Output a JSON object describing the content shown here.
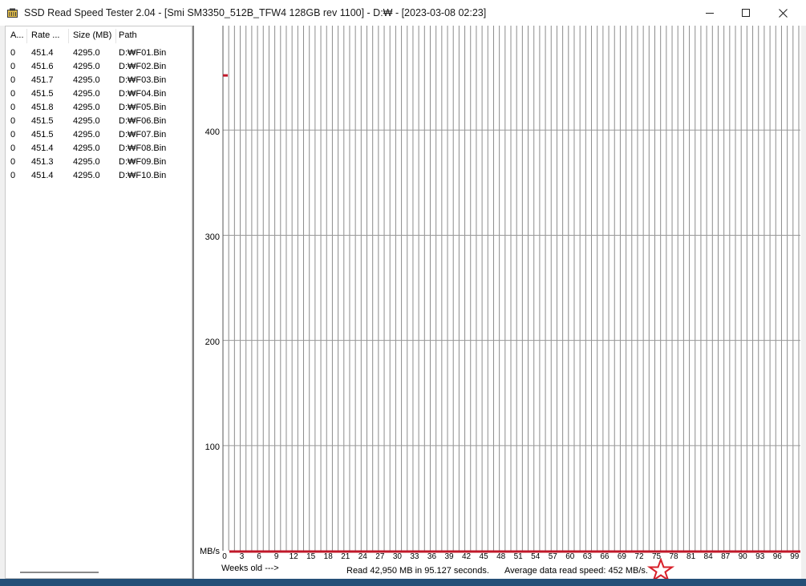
{
  "window": {
    "title": "SSD Read Speed Tester 2.04 - [Smi SM3350_512B_TFW4 128GB rev 1100] - D:₩ - [2023-03-08 02:23]",
    "icon": "drive-icon"
  },
  "controls": {
    "minimize": "minimize-icon",
    "maximize": "maximize-icon",
    "close": "close-icon"
  },
  "list": {
    "columns": [
      "A...",
      "Rate ...",
      "Size (MB)",
      "Path"
    ],
    "rows": [
      {
        "age": "0",
        "rate": "451.4",
        "size": "4295.0",
        "path": "D:₩F01.Bin"
      },
      {
        "age": "0",
        "rate": "451.6",
        "size": "4295.0",
        "path": "D:₩F02.Bin"
      },
      {
        "age": "0",
        "rate": "451.7",
        "size": "4295.0",
        "path": "D:₩F03.Bin"
      },
      {
        "age": "0",
        "rate": "451.5",
        "size": "4295.0",
        "path": "D:₩F04.Bin"
      },
      {
        "age": "0",
        "rate": "451.8",
        "size": "4295.0",
        "path": "D:₩F05.Bin"
      },
      {
        "age": "0",
        "rate": "451.5",
        "size": "4295.0",
        "path": "D:₩F06.Bin"
      },
      {
        "age": "0",
        "rate": "451.5",
        "size": "4295.0",
        "path": "D:₩F07.Bin"
      },
      {
        "age": "0",
        "rate": "451.4",
        "size": "4295.0",
        "path": "D:₩F08.Bin"
      },
      {
        "age": "0",
        "rate": "451.3",
        "size": "4295.0",
        "path": "D:₩F09.Bin"
      },
      {
        "age": "0",
        "rate": "451.4",
        "size": "4295.0",
        "path": "D:₩F10.Bin"
      }
    ]
  },
  "graph": {
    "y_unit": "MB/s",
    "y_ticks": [
      "100",
      "200",
      "300",
      "400"
    ],
    "x_label": "Weeks old --->",
    "summary": "Read 42,950 MB in 95.127 seconds.",
    "average": "Average data read speed: 452 MB/s.",
    "line_color": "#c0182a",
    "star_color": "#d8202a"
  },
  "chart_data": {
    "type": "line",
    "xlabel": "Weeks old --->",
    "ylabel": "MB/s",
    "x_ticks": [
      "0",
      "3",
      "6",
      "9",
      "12",
      "15",
      "18",
      "21",
      "24",
      "27",
      "30",
      "33",
      "36",
      "39",
      "42",
      "45",
      "48",
      "51",
      "54",
      "57",
      "60",
      "63",
      "66",
      "69",
      "72",
      "75",
      "78",
      "81",
      "84",
      "87",
      "90",
      "93",
      "96",
      "99"
    ],
    "xlim": [
      0,
      99
    ],
    "ylim": [
      0,
      500
    ],
    "y_ticks": [
      100,
      200,
      300,
      400
    ],
    "grid": true,
    "series": [
      {
        "x": [
          0
        ],
        "y": [
          452
        ],
        "color": "#c0182a"
      }
    ]
  }
}
